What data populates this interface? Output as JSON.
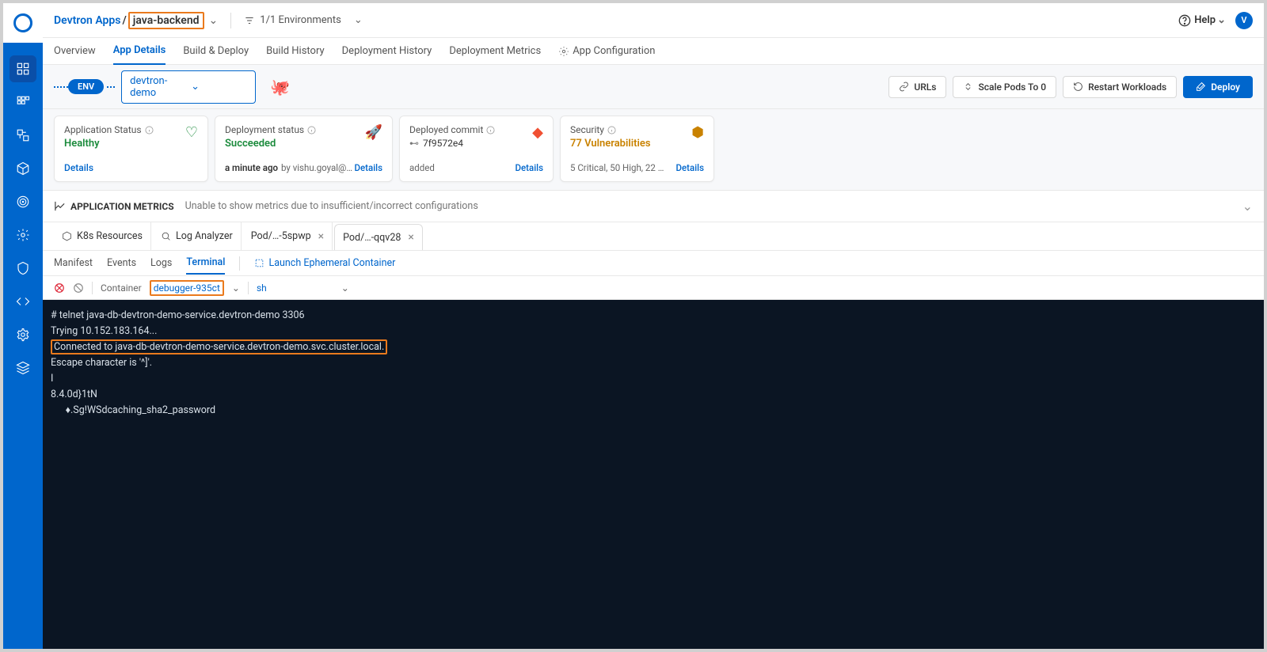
{
  "breadcrumb": {
    "root": "Devtron Apps",
    "sep": "/",
    "app": "java-backend"
  },
  "env_filter": {
    "text": "1/1 Environments"
  },
  "help": {
    "label": "Help"
  },
  "avatar": {
    "initial": "V"
  },
  "tabs": [
    "Overview",
    "App Details",
    "Build & Deploy",
    "Build History",
    "Deployment History",
    "Deployment Metrics",
    "App Configuration"
  ],
  "env_row": {
    "pill": "ENV",
    "selected": "devtron-demo",
    "urls": "URLs",
    "scale": "Scale Pods To 0",
    "restart": "Restart Workloads",
    "deploy": "Deploy"
  },
  "cards": {
    "appstatus": {
      "title": "Application Status",
      "value": "Healthy",
      "details": "Details",
      "icon": "💚"
    },
    "deploystatus": {
      "title": "Deployment status",
      "value": "Succeeded",
      "time": "a minute ago",
      "by": "by vishu.goyal@…",
      "details": "Details",
      "icon": "🚀"
    },
    "commit": {
      "title": "Deployed commit",
      "value": "7f9572e4",
      "sub": "added",
      "details": "Details",
      "icon": "🔶"
    },
    "security": {
      "title": "Security",
      "value": "77 Vulnerabilities",
      "sub": "5 Critical, 50 High, 22 …",
      "details": "Details",
      "icon": "🪲"
    }
  },
  "metrics": {
    "title": "APPLICATION METRICS",
    "msg": "Unable to show metrics due to insufficient/incorrect configurations"
  },
  "sec_tabs": {
    "k8s": "K8s Resources",
    "log": "Log Analyzer",
    "pod1": "Pod/…-5spwp",
    "pod2": "Pod/…-qqv28"
  },
  "subtabs": {
    "manifest": "Manifest",
    "events": "Events",
    "logs": "Logs",
    "terminal": "Terminal",
    "launch": "Launch Ephemeral Container"
  },
  "term_ctrl": {
    "container_label": "Container",
    "container_value": "debugger-935ct",
    "shell": "sh"
  },
  "terminal": {
    "l1": "# telnet java-db-devtron-demo-service.devtron-demo 3306",
    "l2": "Trying 10.152.183.164...",
    "l3": "Connected to java-db-devtron-demo-service.devtron-demo.svc.cluster.local.",
    "l4": "Escape character is '^]'.",
    "l5": "I",
    "l6": "8.4.0d}1tN",
    "l7": "      ♦.Sg!WSdcaching_sha2_password"
  }
}
